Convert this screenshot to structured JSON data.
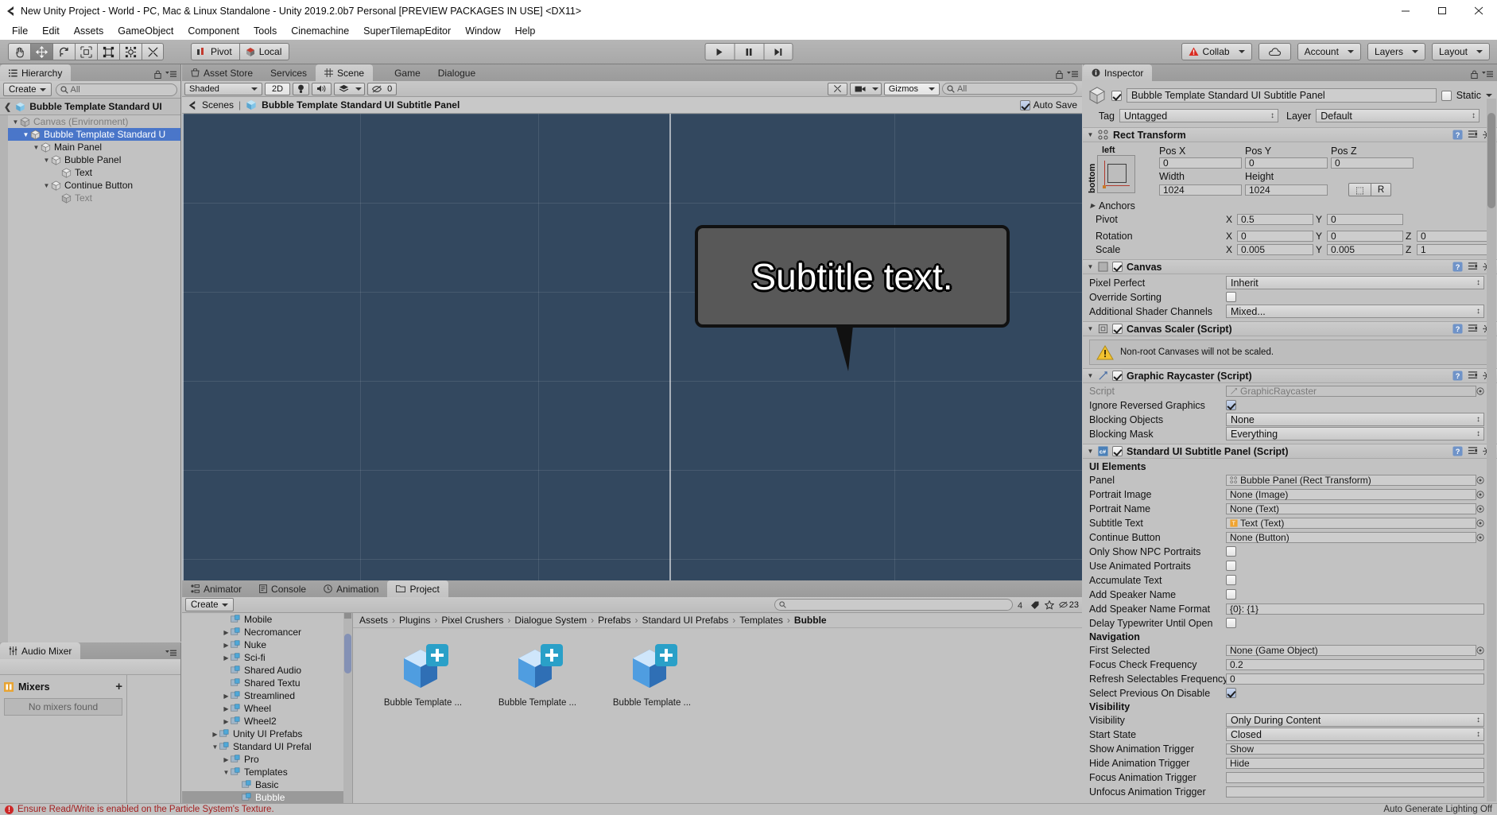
{
  "window": {
    "title": "New Unity Project - World - PC, Mac & Linux Standalone - Unity 2019.2.0b7 Personal [PREVIEW PACKAGES IN USE] <DX11>",
    "minimize": "—",
    "maximize": "▢",
    "close": "✕"
  },
  "menu": [
    "File",
    "Edit",
    "Assets",
    "GameObject",
    "Component",
    "Tools",
    "Cinemachine",
    "SuperTilemapEditor",
    "Window",
    "Help"
  ],
  "toolbar": {
    "tools": [
      "hand-tool",
      "move-tool",
      "rotate-tool",
      "scale-tool",
      "rect-tool",
      "transform-tool",
      "custom-tool"
    ],
    "pivot": "Pivot",
    "local": "Local",
    "play": "play",
    "pause": "pause",
    "step": "step",
    "collab": "Collab",
    "cloud": "cloud",
    "account": "Account",
    "layers": "Layers",
    "layout": "Layout"
  },
  "hierarchy": {
    "tab": "Hierarchy",
    "create": "Create",
    "search_placeholder": "All",
    "breadcrumb": "Bubble Template Standard UI",
    "items": [
      {
        "label": "Canvas (Environment)",
        "depth": 0,
        "arrow": "▼",
        "selected": false,
        "dim": true
      },
      {
        "label": "Bubble Template Standard U",
        "depth": 1,
        "arrow": "▼",
        "selected": true,
        "dim": false
      },
      {
        "label": "Main Panel",
        "depth": 2,
        "arrow": "▼",
        "selected": false,
        "dim": false
      },
      {
        "label": "Bubble Panel",
        "depth": 3,
        "arrow": "▼",
        "selected": false,
        "dim": false
      },
      {
        "label": "Text",
        "depth": 4,
        "arrow": "",
        "selected": false,
        "dim": false
      },
      {
        "label": "Continue Button",
        "depth": 3,
        "arrow": "▼",
        "selected": false,
        "dim": false
      },
      {
        "label": "Text",
        "depth": 4,
        "arrow": "",
        "selected": false,
        "dim": true
      }
    ]
  },
  "scene": {
    "tabs": [
      "Asset Store",
      "Services",
      "Scene",
      "Game",
      "Dialogue"
    ],
    "active_tab": "Scene",
    "shading": "Shaded",
    "mode_2d": "2D",
    "gizmos": "Gizmos",
    "gizmo_search_placeholder": "All",
    "hidden_count": "0",
    "breadcrumb_root": "Scenes",
    "breadcrumb_object": "Bubble Template Standard UI Subtitle Panel",
    "auto_save": "Auto Save",
    "bubble_text": "Subtitle text."
  },
  "project": {
    "tabs": [
      "Animator",
      "Console",
      "Animation",
      "Project"
    ],
    "active_tab": "Project",
    "create": "Create",
    "search_placeholder": "",
    "item_count": "23",
    "breadcrumb": [
      "Assets",
      "Plugins",
      "Pixel Crushers",
      "Dialogue System",
      "Prefabs",
      "Standard UI Prefabs",
      "Templates",
      "Bubble"
    ],
    "tree": [
      {
        "label": "Mobile",
        "depth": 3,
        "arrow": "",
        "selected": false
      },
      {
        "label": "Necromancer",
        "depth": 3,
        "arrow": "▶",
        "selected": false
      },
      {
        "label": "Nuke",
        "depth": 3,
        "arrow": "▶",
        "selected": false
      },
      {
        "label": "Sci-fi",
        "depth": 3,
        "arrow": "▶",
        "selected": false
      },
      {
        "label": "Shared Audio",
        "depth": 3,
        "arrow": "",
        "selected": false
      },
      {
        "label": "Shared Textu",
        "depth": 3,
        "arrow": "",
        "selected": false
      },
      {
        "label": "Streamlined",
        "depth": 3,
        "arrow": "▶",
        "selected": false
      },
      {
        "label": "Wheel",
        "depth": 3,
        "arrow": "▶",
        "selected": false
      },
      {
        "label": "Wheel2",
        "depth": 3,
        "arrow": "▶",
        "selected": false
      },
      {
        "label": "Unity UI Prefabs",
        "depth": 2,
        "arrow": "▶",
        "selected": false
      },
      {
        "label": "Standard UI Prefal",
        "depth": 2,
        "arrow": "▼",
        "selected": false
      },
      {
        "label": "Pro",
        "depth": 3,
        "arrow": "▶",
        "selected": false
      },
      {
        "label": "Templates",
        "depth": 3,
        "arrow": "▼",
        "selected": false
      },
      {
        "label": "Basic",
        "depth": 4,
        "arrow": "",
        "selected": false
      },
      {
        "label": "Bubble",
        "depth": 4,
        "arrow": "",
        "selected": true
      }
    ],
    "assets": [
      {
        "label": "Bubble Template ..."
      },
      {
        "label": "Bubble Template ..."
      },
      {
        "label": "Bubble Template ..."
      }
    ]
  },
  "mixer": {
    "tab": "Audio Mixer",
    "heading": "Mixers",
    "add": "+",
    "empty": "No mixers found"
  },
  "inspector": {
    "tab": "Inspector",
    "object_name": "Bubble Template Standard UI Subtitle Panel",
    "static_label": "Static",
    "tag_label": "Tag",
    "tag_value": "Untagged",
    "layer_label": "Layer",
    "layer_value": "Default",
    "rect_transform": {
      "title": "Rect Transform",
      "anchor_top": "left",
      "anchor_side": "bottom",
      "pos_x_label": "Pos X",
      "pos_x": "0",
      "pos_y_label": "Pos Y",
      "pos_y": "0",
      "pos_z_label": "Pos Z",
      "pos_z": "0",
      "width_label": "Width",
      "width": "1024",
      "height_label": "Height",
      "height": "1024",
      "blueprint": "⬚",
      "raw": "R",
      "anchors_label": "Anchors",
      "pivot_label": "Pivot",
      "pivot_x": "0.5",
      "pivot_y": "0",
      "rotation_label": "Rotation",
      "rot_x": "0",
      "rot_y": "0",
      "rot_z": "0",
      "scale_label": "Scale",
      "scale_x": "0.005",
      "scale_y": "0.005",
      "scale_z": "1"
    },
    "canvas": {
      "title": "Canvas",
      "pixel_perfect_label": "Pixel Perfect",
      "pixel_perfect": "Inherit",
      "override_sorting_label": "Override Sorting",
      "shader_channels_label": "Additional Shader Channels",
      "shader_channels": "Mixed..."
    },
    "canvas_scaler": {
      "title": "Canvas Scaler (Script)",
      "warning": "Non-root Canvases will not be scaled."
    },
    "graphic_raycaster": {
      "title": "Graphic Raycaster (Script)",
      "script_label": "Script",
      "script_value": "GraphicRaycaster",
      "ignore_label": "Ignore Reversed Graphics",
      "blocking_objects_label": "Blocking Objects",
      "blocking_objects": "None",
      "blocking_mask_label": "Blocking Mask",
      "blocking_mask": "Everything"
    },
    "subtitle_panel": {
      "title": "Standard UI Subtitle Panel (Script)",
      "section_ui": "UI Elements",
      "panel_label": "Panel",
      "panel_value": "Bubble Panel (Rect Transform)",
      "portrait_image_label": "Portrait Image",
      "portrait_image": "None (Image)",
      "portrait_name_label": "Portrait Name",
      "portrait_name": "None (Text)",
      "subtitle_text_label": "Subtitle Text",
      "subtitle_text": "Text (Text)",
      "continue_button_label": "Continue Button",
      "continue_button": "None (Button)",
      "only_npc_label": "Only Show NPC Portraits",
      "animated_portraits_label": "Use Animated Portraits",
      "accumulate_label": "Accumulate Text",
      "add_speaker_label": "Add Speaker Name",
      "add_speaker_format_label": "Add Speaker Name Format",
      "add_speaker_format": "{0}: {1}",
      "delay_typewriter_label": "Delay Typewriter Until Open",
      "section_nav": "Navigation",
      "first_selected_label": "First Selected",
      "first_selected": "None (Game Object)",
      "focus_check_label": "Focus Check Frequency",
      "focus_check": "0.2",
      "refresh_sel_label": "Refresh Selectables Frequency",
      "refresh_sel": "0",
      "select_prev_label": "Select Previous On Disable",
      "section_vis": "Visibility",
      "visibility_label": "Visibility",
      "visibility": "Only During Content",
      "start_state_label": "Start State",
      "start_state": "Closed",
      "show_anim_label": "Show Animation Trigger",
      "show_anim": "Show",
      "hide_anim_label": "Hide Animation Trigger",
      "hide_anim": "Hide",
      "focus_anim_label": "Focus Animation Trigger",
      "focus_anim": "",
      "unfocus_anim_label": "Unfocus Animation Trigger",
      "unfocus_anim": ""
    }
  },
  "status": {
    "error": "Ensure Read/Write is enabled on the Particle System's Texture.",
    "right": "Auto Generate Lighting Off"
  },
  "colors": {
    "accent_blue": "#4a76c9",
    "scene_bg": "#33485f",
    "error_red": "#a32020",
    "prefab_blue": "#2aa0c8"
  }
}
